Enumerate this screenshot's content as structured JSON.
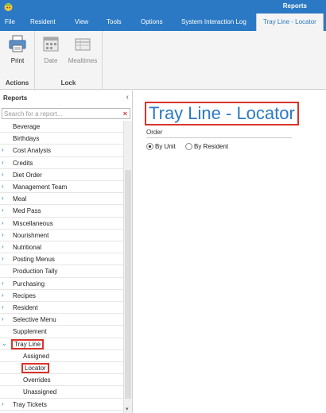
{
  "window": {
    "title": "Reports"
  },
  "menu": {
    "items": [
      {
        "label": "File"
      },
      {
        "label": "Resident"
      },
      {
        "label": "View"
      },
      {
        "label": "Tools"
      },
      {
        "label": "Options"
      },
      {
        "label": "System Interaction Log"
      },
      {
        "label": "Tray Line - Locator"
      }
    ],
    "active_index": 6
  },
  "ribbon": {
    "actions": {
      "label": "Actions",
      "print": "Print"
    },
    "lock": {
      "label": "Lock",
      "date": "Date",
      "mealtimes": "Mealtimes"
    }
  },
  "left_panel": {
    "title": "Reports",
    "search_placeholder": "Search for a report...",
    "tree": [
      {
        "label": "Beverage",
        "expandable": false,
        "level": 0
      },
      {
        "label": "Birthdays",
        "expandable": false,
        "level": 0
      },
      {
        "label": "Cost Analysis",
        "expandable": true,
        "level": 0
      },
      {
        "label": "Credits",
        "expandable": true,
        "level": 0
      },
      {
        "label": "Diet Order",
        "expandable": true,
        "level": 0
      },
      {
        "label": "Management Team",
        "expandable": true,
        "level": 0
      },
      {
        "label": "Meal",
        "expandable": true,
        "level": 0
      },
      {
        "label": "Med Pass",
        "expandable": true,
        "level": 0
      },
      {
        "label": "Miscellaneous",
        "expandable": true,
        "level": 0
      },
      {
        "label": "Nourishment",
        "expandable": true,
        "level": 0
      },
      {
        "label": "Nutritional",
        "expandable": true,
        "level": 0
      },
      {
        "label": "Posting Menus",
        "expandable": true,
        "level": 0
      },
      {
        "label": "Production Tally",
        "expandable": false,
        "level": 0
      },
      {
        "label": "Purchasing",
        "expandable": true,
        "level": 0
      },
      {
        "label": "Recipes",
        "expandable": true,
        "level": 0
      },
      {
        "label": "Resident",
        "expandable": true,
        "level": 0
      },
      {
        "label": "Selective Menu",
        "expandable": true,
        "level": 0
      },
      {
        "label": "Supplement",
        "expandable": false,
        "level": 0
      },
      {
        "label": "Tray Line",
        "expandable": true,
        "expanded": true,
        "level": 0
      },
      {
        "label": "Assigned",
        "level": 1
      },
      {
        "label": "Locator",
        "level": 1,
        "selected": true
      },
      {
        "label": "Overrides",
        "level": 1
      },
      {
        "label": "Unassigned",
        "level": 1
      },
      {
        "label": "Tray Tickets",
        "expandable": true,
        "level": 0
      }
    ]
  },
  "main": {
    "title": "Tray Line - Locator",
    "order": {
      "label": "Order",
      "options": [
        {
          "label": "By Unit",
          "selected": true
        },
        {
          "label": "By Resident",
          "selected": false
        }
      ]
    }
  },
  "colors": {
    "accent": "#2b79c5",
    "highlight": "#d9342b"
  }
}
